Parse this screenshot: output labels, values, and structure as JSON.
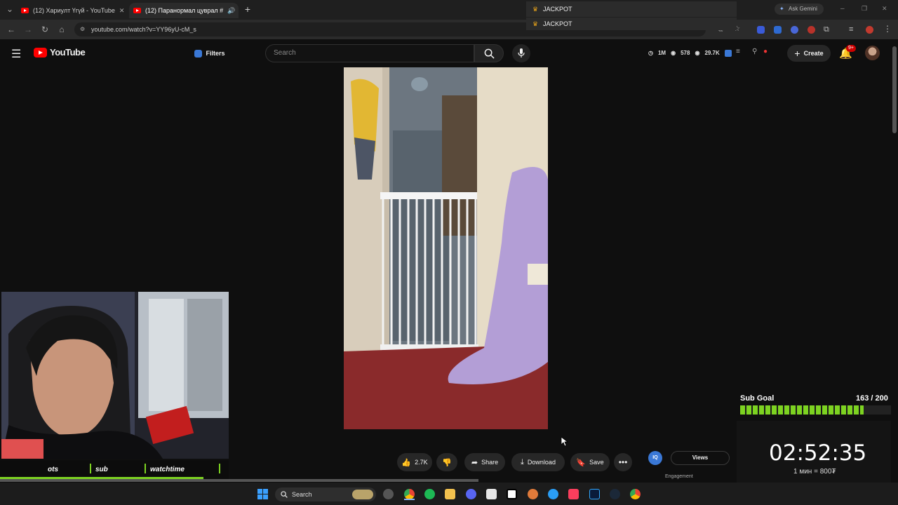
{
  "browser": {
    "tabs": [
      {
        "title": "(12) Хариулт Үгүй - YouTube"
      },
      {
        "title": "(12) Паранормал цуврал #"
      }
    ],
    "url": "youtube.com/watch?v=YY96yU-cM_s",
    "ask_gemini": "Ask Gemini",
    "jackpot_1": "JACKPOT",
    "jackpot_2": "JACKPOT"
  },
  "header": {
    "logo": "YouTube",
    "filters_label": "Filters",
    "search_placeholder": "Search",
    "stats": {
      "views": "1M",
      "watching": "578",
      "likes": "29.7K"
    },
    "create_label": "Create",
    "notif_badge": "9+"
  },
  "actions": {
    "like_count": "2.7K",
    "share": "Share",
    "download": "Download",
    "save": "Save",
    "views_label": "Views",
    "engagement_label": "Engagement"
  },
  "stream_overlay": {
    "bar_items": [
      "ots",
      "sub",
      "watchtime"
    ],
    "sub_goal_label": "Sub Goal",
    "sub_goal_value": "163 / 200",
    "sub_goal_progress": 0.815,
    "timer": "02:52:35",
    "rate": "1 мин = 800₮"
  },
  "taskbar": {
    "search_label": "Search"
  },
  "colors": {
    "youtube_red": "#ff0000",
    "progress_green": "#7dd321",
    "timer_yellow": "#f2e600"
  }
}
